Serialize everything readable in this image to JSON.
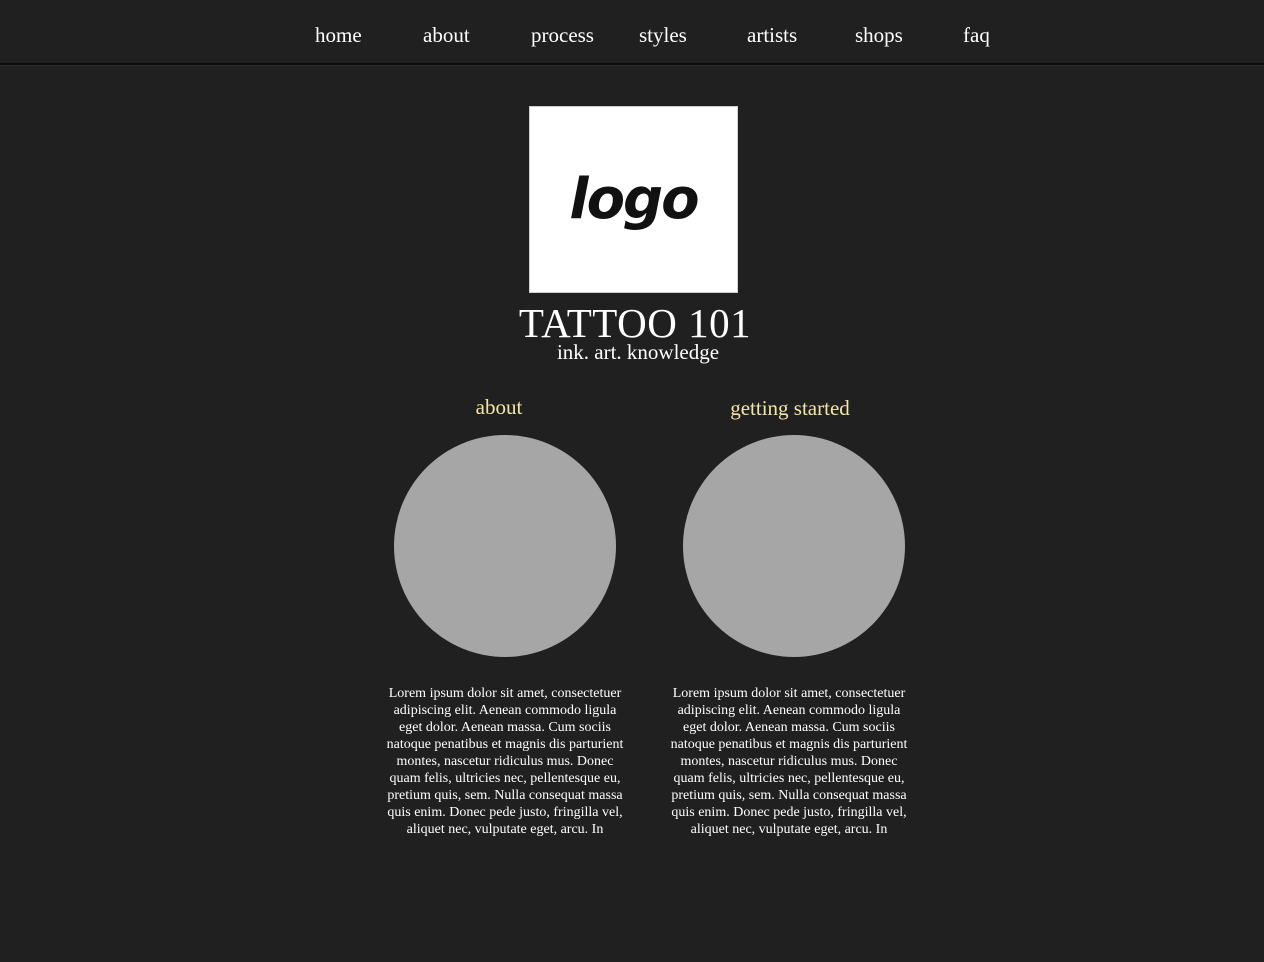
{
  "nav": {
    "items": [
      {
        "label": "home"
      },
      {
        "label": "about"
      },
      {
        "label": "process"
      },
      {
        "label": "styles"
      },
      {
        "label": "artists"
      },
      {
        "label": "shops"
      },
      {
        "label": "faq"
      }
    ]
  },
  "logo": {
    "text": "logo"
  },
  "header": {
    "title": "TATTOO 101",
    "tagline": "ink. art. knowledge"
  },
  "sections": [
    {
      "heading": "about",
      "body": "Lorem ipsum dolor sit amet, consectetuer adipiscing elit. Aenean commodo ligula eget dolor. Aenean massa. Cum sociis natoque penatibus et magnis dis parturient montes, nascetur ridiculus mus. Donec quam felis, ultricies nec, pellentesque eu, pretium quis, sem. Nulla consequat massa quis enim. Donec pede justo, fringilla vel, aliquet nec, vulputate eget, arcu. In"
    },
    {
      "heading": "getting started",
      "body": "Lorem ipsum dolor sit amet, consectetuer adipiscing elit. Aenean commodo ligula eget dolor. Aenean massa. Cum sociis natoque penatibus et magnis dis parturient montes, nascetur ridiculus mus. Donec quam felis, ultricies nec, pellentesque eu, pretium quis, sem. Nulla consequat massa quis enim. Donec pede justo, fringilla vel, aliquet nec, vulputate eget, arcu. In"
    }
  ],
  "colors": {
    "background": "#202020",
    "heading_accent": "#f3e6a8",
    "placeholder_circle": "#a6a6a6",
    "text": "#ffffff"
  }
}
